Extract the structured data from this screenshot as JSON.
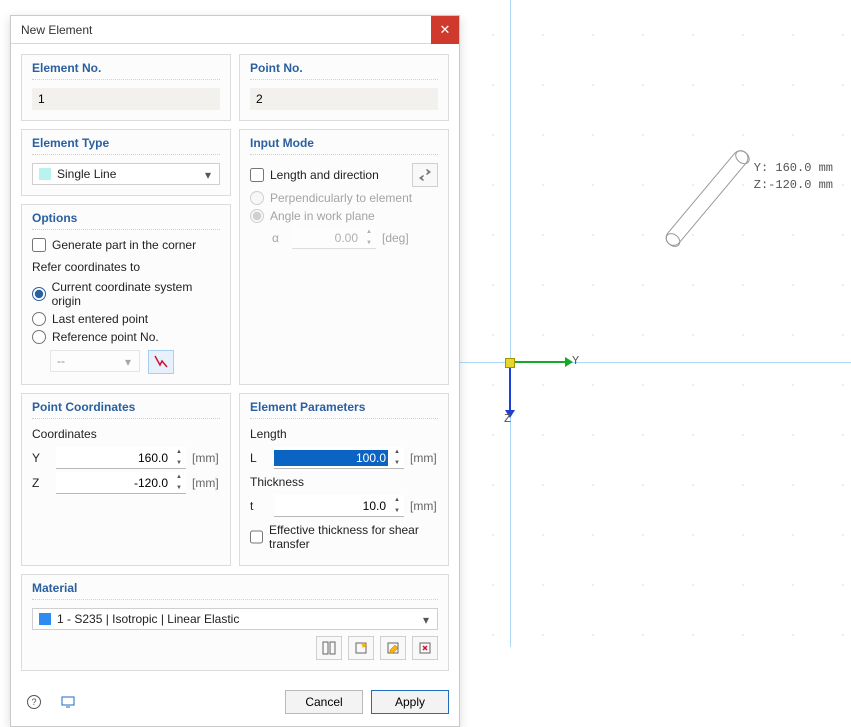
{
  "dialog": {
    "title": "New Element",
    "element_no": {
      "label": "Element No.",
      "value": "1"
    },
    "point_no": {
      "label": "Point No.",
      "value": "2"
    },
    "element_type": {
      "label": "Element Type",
      "value": "Single Line"
    },
    "options": {
      "label": "Options",
      "generate_part": "Generate part in the corner",
      "refer_label": "Refer coordinates to",
      "current": "Current coordinate system origin",
      "last": "Last entered point",
      "refpoint": "Reference point No.",
      "refvalue": "--"
    },
    "input_mode": {
      "label": "Input Mode",
      "length_dir": "Length and direction",
      "perp": "Perpendicularly to element",
      "angle_plane": "Angle in work plane",
      "alpha_sym": "α",
      "alpha_val": "0.00",
      "alpha_unit": "[deg]"
    },
    "point_coords": {
      "label": "Point Coordinates",
      "coords_label": "Coordinates",
      "y_sym": "Y",
      "y_val": "160.0",
      "z_sym": "Z",
      "z_val": "-120.0",
      "unit": "[mm]"
    },
    "elem_params": {
      "label": "Element Parameters",
      "length_label": "Length",
      "l_sym": "L",
      "l_val": "100.0",
      "thick_label": "Thickness",
      "t_sym": "t",
      "t_val": "10.0",
      "unit": "[mm]",
      "eff_thick": "Effective thickness for shear transfer"
    },
    "material": {
      "label": "Material",
      "value": "1 - S235 | Isotropic | Linear Elastic"
    },
    "footer": {
      "cancel": "Cancel",
      "apply": "Apply"
    }
  },
  "canvas": {
    "axis_y": "Y",
    "axis_z": "Z",
    "readout_y": "Y: 160.0 mm",
    "readout_z": "Z:-120.0 mm"
  }
}
